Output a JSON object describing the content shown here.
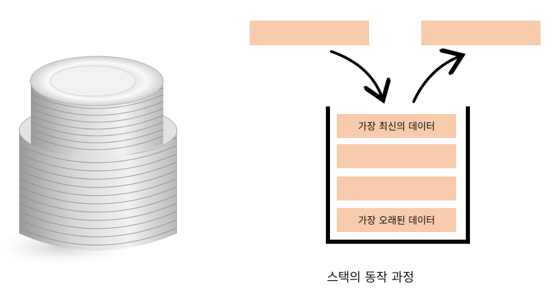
{
  "photo": {
    "subject": "stack-of-plates"
  },
  "stack": {
    "colors": {
      "slot_fill": "#f7cbac",
      "wall": "#000000"
    },
    "slots": [
      {
        "label": "가장 최신의 데이터"
      },
      {
        "label": ""
      },
      {
        "label": ""
      },
      {
        "label": "가장 오래된 데이터"
      }
    ],
    "push_box_label": "",
    "pop_box_label": ""
  },
  "caption": "스택의 동작 과정"
}
